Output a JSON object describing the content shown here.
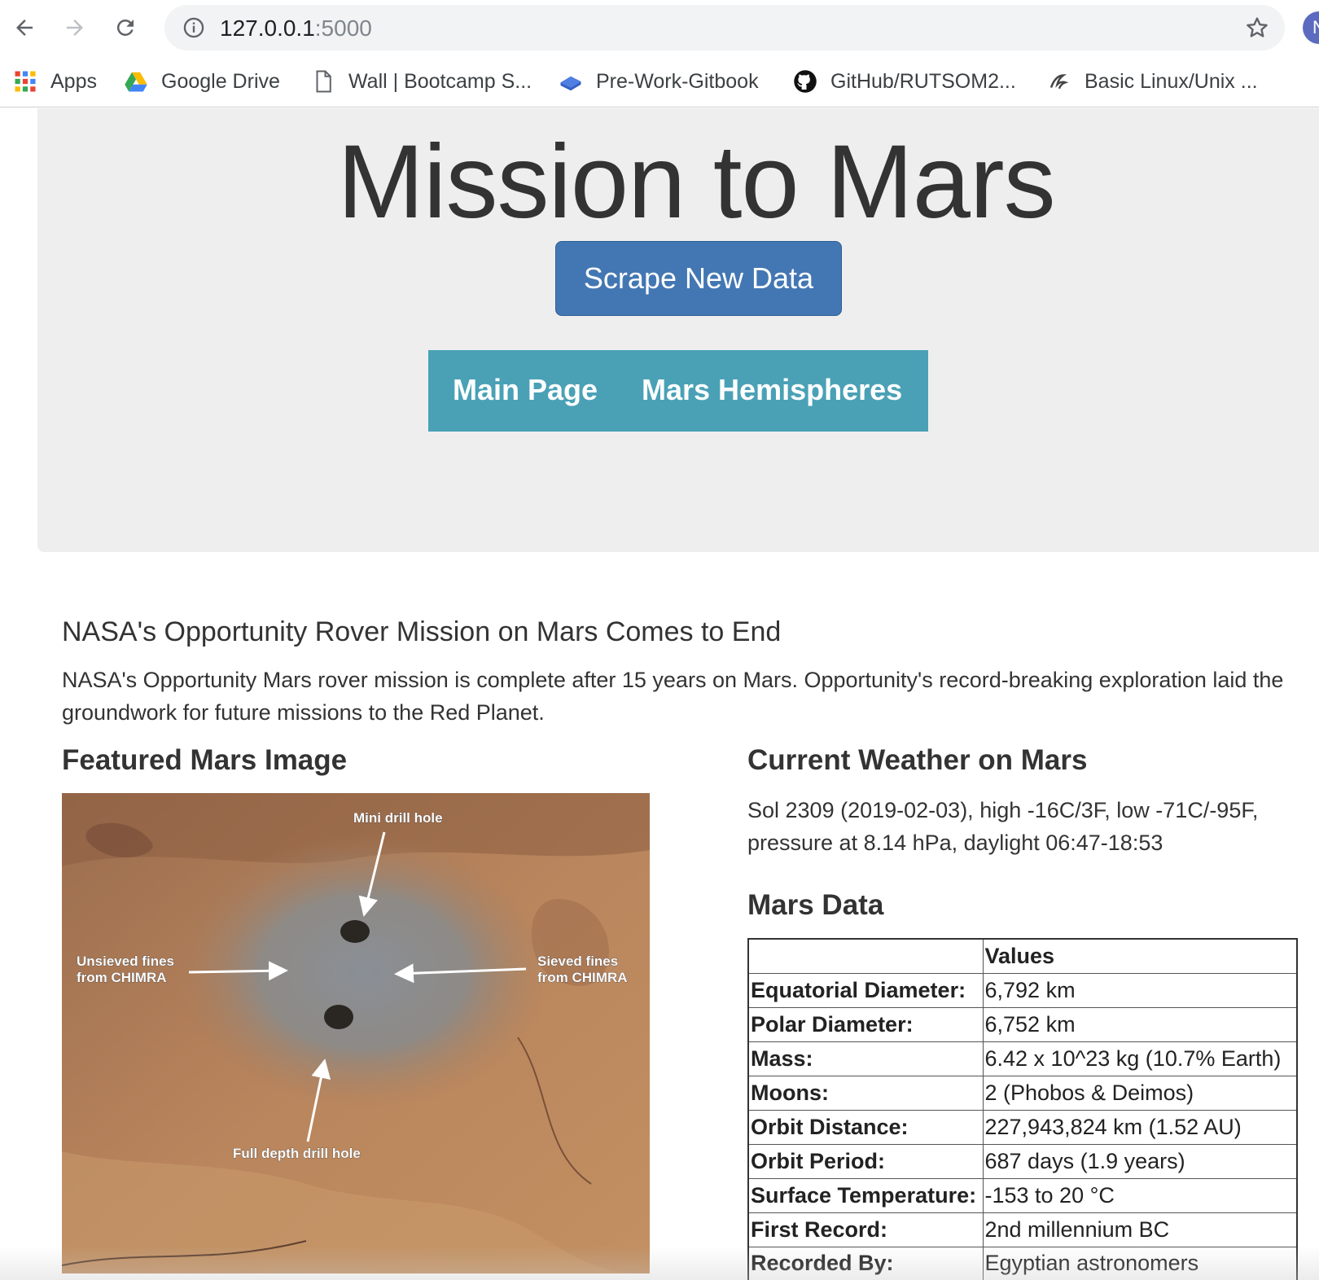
{
  "browser": {
    "url_host": "127.0.0.1",
    "url_port": ":5000",
    "profile_initial": "N",
    "bookmarks": [
      {
        "label": "Apps",
        "icon": "apps-grid-icon"
      },
      {
        "label": "Google Drive",
        "icon": "google-drive-icon"
      },
      {
        "label": "Wall | Bootcamp S...",
        "icon": "document-icon"
      },
      {
        "label": "Pre-Work-Gitbook",
        "icon": "gitbook-icon"
      },
      {
        "label": "GitHub/RUTSOM2...",
        "icon": "github-icon"
      },
      {
        "label": "Basic Linux/Unix ...",
        "icon": "site-icon"
      }
    ]
  },
  "page": {
    "title": "Mission to Mars",
    "scrape_button": "Scrape New Data",
    "nav": {
      "main": "Main Page",
      "hemispheres": "Mars Hemispheres"
    },
    "news": {
      "title": "NASA's Opportunity Rover Mission on Mars Comes to End",
      "body": "NASA's Opportunity Mars rover mission is complete after 15 years on Mars. Opportunity's record-breaking exploration laid the groundwork for future missions to the Red Planet."
    },
    "featured": {
      "heading": "Featured Mars Image",
      "labels": {
        "mini": "Mini drill hole",
        "unsieved_1": "Unsieved fines",
        "unsieved_2": "from CHIMRA",
        "sieved_1": "Sieved fines",
        "sieved_2": "from CHIMRA",
        "full": "Full depth drill hole"
      }
    },
    "weather": {
      "heading": "Current Weather on Mars",
      "text": "Sol 2309 (2019-02-03), high -16C/3F, low -71C/-95F, pressure at 8.14 hPa, daylight 06:47-18:53"
    },
    "mars_data": {
      "heading": "Mars Data",
      "column_header": "Values",
      "rows": [
        {
          "label": "Equatorial Diameter:",
          "value": "6,792 km"
        },
        {
          "label": "Polar Diameter:",
          "value": "6,752 km"
        },
        {
          "label": "Mass:",
          "value": "6.42 x 10^23 kg (10.7% Earth)"
        },
        {
          "label": "Moons:",
          "value": "2 (Phobos & Deimos)"
        },
        {
          "label": "Orbit Distance:",
          "value": "227,943,824 km (1.52 AU)"
        },
        {
          "label": "Orbit Period:",
          "value": "687 days (1.9 years)"
        },
        {
          "label": "Surface Temperature:",
          "value": "-153 to 20 °C"
        },
        {
          "label": "First Record:",
          "value": "2nd millennium BC"
        },
        {
          "label": "Recorded By:",
          "value": "Egyptian astronomers"
        }
      ]
    }
  },
  "colors": {
    "jumbotron": "#eeeeee",
    "scrape_button": "#4377b3",
    "navbar": "#4aa1b6"
  }
}
